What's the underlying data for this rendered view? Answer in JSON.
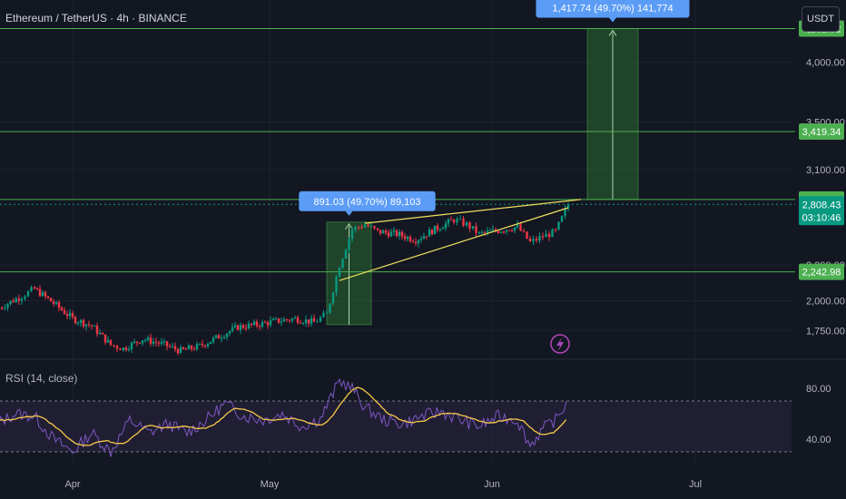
{
  "header": {
    "symbol_title": "Ethereum / TetherUS · 4h · BINANCE",
    "currency_label": "USDT"
  },
  "indicator": {
    "label": "RSI (14, close)"
  },
  "colors": {
    "background": "#131722",
    "level_line": "#4caf50",
    "level_tag": "#4caf50",
    "current_tag": "#089981",
    "wedge_line": "#f0e160",
    "callout_bg": "#5b9cf6",
    "projection_fill": "#2e7d32",
    "rsi_line": "#7e57c2",
    "rsi_ma": "#f7c948",
    "rsi_band": "#2a2340",
    "lightning": "#ab47bc",
    "candle_up": "#089981",
    "candle_down": "#f23645"
  },
  "chart_data": {
    "type": "candlestick",
    "title": "Ethereum / TetherUS · 4h · BINANCE",
    "price_axis": {
      "range": [
        1700,
        4400
      ],
      "ticks": [
        1750,
        2000,
        2300,
        3100,
        3500,
        4000
      ],
      "tick_labels": [
        "1,750.00",
        "2,000.00",
        "2,300.00",
        "3,100.00",
        "3,500.00",
        "4,000.00"
      ]
    },
    "time_axis": {
      "range_days": [
        0,
        128
      ],
      "ticks": [
        {
          "label": "Apr",
          "day": 12
        },
        {
          "label": "May",
          "day": 43
        },
        {
          "label": "Jun",
          "day": 78
        },
        {
          "label": "Jul",
          "day": 110
        }
      ]
    },
    "horizontal_levels": [
      {
        "value": 4282.52,
        "label": "4,282.52"
      },
      {
        "value": 3419.34,
        "label": "3,419.34"
      },
      {
        "value": 2849.6,
        "label": "2,849.60"
      },
      {
        "value": 2242.98,
        "label": "2,242.98"
      }
    ],
    "current_price": {
      "value": 2808.43,
      "label": "2,808.43",
      "countdown": "03:10:46"
    },
    "close_series": [
      {
        "day": 0,
        "price": 1930
      },
      {
        "day": 4,
        "price": 2040
      },
      {
        "day": 6,
        "price": 2100
      },
      {
        "day": 9,
        "price": 1980
      },
      {
        "day": 12,
        "price": 1850
      },
      {
        "day": 15,
        "price": 1790
      },
      {
        "day": 18,
        "price": 1630
      },
      {
        "day": 20,
        "price": 1600
      },
      {
        "day": 23,
        "price": 1680
      },
      {
        "day": 26,
        "price": 1640
      },
      {
        "day": 29,
        "price": 1580
      },
      {
        "day": 32,
        "price": 1620
      },
      {
        "day": 35,
        "price": 1700
      },
      {
        "day": 38,
        "price": 1780
      },
      {
        "day": 41,
        "price": 1800
      },
      {
        "day": 44,
        "price": 1830
      },
      {
        "day": 47,
        "price": 1850
      },
      {
        "day": 50,
        "price": 1820
      },
      {
        "day": 52,
        "price": 1890
      },
      {
        "day": 54,
        "price": 2300
      },
      {
        "day": 56,
        "price": 2600
      },
      {
        "day": 58,
        "price": 2640
      },
      {
        "day": 60,
        "price": 2580
      },
      {
        "day": 63,
        "price": 2560
      },
      {
        "day": 66,
        "price": 2510
      },
      {
        "day": 69,
        "price": 2600
      },
      {
        "day": 72,
        "price": 2680
      },
      {
        "day": 74,
        "price": 2640
      },
      {
        "day": 76,
        "price": 2560
      },
      {
        "day": 79,
        "price": 2590
      },
      {
        "day": 82,
        "price": 2620
      },
      {
        "day": 84,
        "price": 2490
      },
      {
        "day": 86,
        "price": 2540
      },
      {
        "day": 88,
        "price": 2580
      },
      {
        "day": 90,
        "price": 2808
      }
    ],
    "wedge": {
      "upper": [
        {
          "day": 58,
          "price": 2650
        },
        {
          "day": 92,
          "price": 2850
        }
      ],
      "lower": [
        {
          "day": 54,
          "price": 2170
        },
        {
          "day": 90,
          "price": 2780
        }
      ]
    },
    "measured_moves": [
      {
        "from_day": 52,
        "to_day": 59,
        "low": 1800,
        "high": 2660,
        "label": "891.03 (49.70%) 89,103"
      },
      {
        "from_day": 93,
        "to_day": 101,
        "low": 2850,
        "high": 4282.52,
        "label": "1,417.74 (49.70%) 141,774"
      }
    ],
    "rsi": {
      "name": "RSI (14, close)",
      "range": [
        20,
        100
      ],
      "ticks": [
        80,
        40
      ],
      "tick_labels": [
        "80.00",
        "40.00"
      ],
      "band": [
        70,
        30
      ],
      "values": [
        {
          "day": 0,
          "value": 52
        },
        {
          "day": 3,
          "value": 60
        },
        {
          "day": 6,
          "value": 58
        },
        {
          "day": 9,
          "value": 40
        },
        {
          "day": 12,
          "value": 30
        },
        {
          "day": 15,
          "value": 45
        },
        {
          "day": 18,
          "value": 30
        },
        {
          "day": 21,
          "value": 55
        },
        {
          "day": 24,
          "value": 45
        },
        {
          "day": 27,
          "value": 52
        },
        {
          "day": 30,
          "value": 45
        },
        {
          "day": 33,
          "value": 55
        },
        {
          "day": 36,
          "value": 68
        },
        {
          "day": 39,
          "value": 58
        },
        {
          "day": 42,
          "value": 55
        },
        {
          "day": 45,
          "value": 60
        },
        {
          "day": 48,
          "value": 50
        },
        {
          "day": 51,
          "value": 56
        },
        {
          "day": 54,
          "value": 86
        },
        {
          "day": 56,
          "value": 80
        },
        {
          "day": 58,
          "value": 65
        },
        {
          "day": 61,
          "value": 55
        },
        {
          "day": 64,
          "value": 52
        },
        {
          "day": 67,
          "value": 58
        },
        {
          "day": 70,
          "value": 62
        },
        {
          "day": 73,
          "value": 55
        },
        {
          "day": 76,
          "value": 50
        },
        {
          "day": 79,
          "value": 58
        },
        {
          "day": 82,
          "value": 55
        },
        {
          "day": 84,
          "value": 35
        },
        {
          "day": 86,
          "value": 48
        },
        {
          "day": 88,
          "value": 55
        },
        {
          "day": 90,
          "value": 70
        }
      ]
    }
  }
}
